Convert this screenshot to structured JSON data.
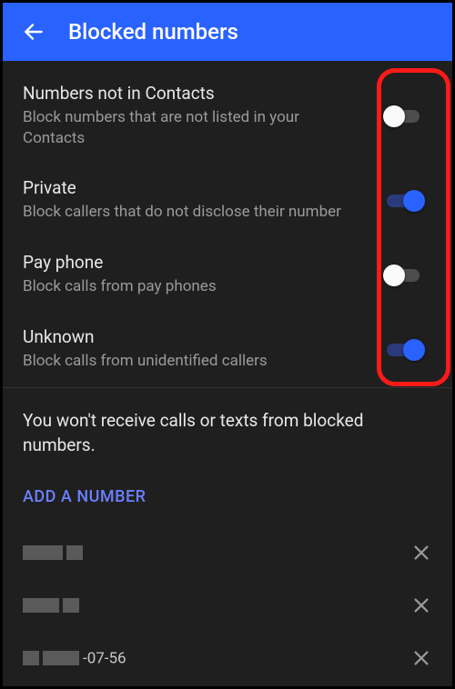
{
  "header": {
    "title": "Blocked numbers"
  },
  "rows": [
    {
      "title": "Numbers not in Contacts",
      "sub": "Block numbers that are not listed in your Contacts",
      "on": false
    },
    {
      "title": "Private",
      "sub": "Block callers that do not disclose their number",
      "on": true
    },
    {
      "title": "Pay phone",
      "sub": "Block calls from pay phones",
      "on": false
    },
    {
      "title": "Unknown",
      "sub": "Block calls from unidentified callers",
      "on": true
    }
  ],
  "info": "You won't receive calls or texts from blocked numbers.",
  "add_label": "ADD A NUMBER",
  "numbers": [
    {
      "suffix": ""
    },
    {
      "suffix": ""
    },
    {
      "suffix": "-07-56"
    }
  ]
}
